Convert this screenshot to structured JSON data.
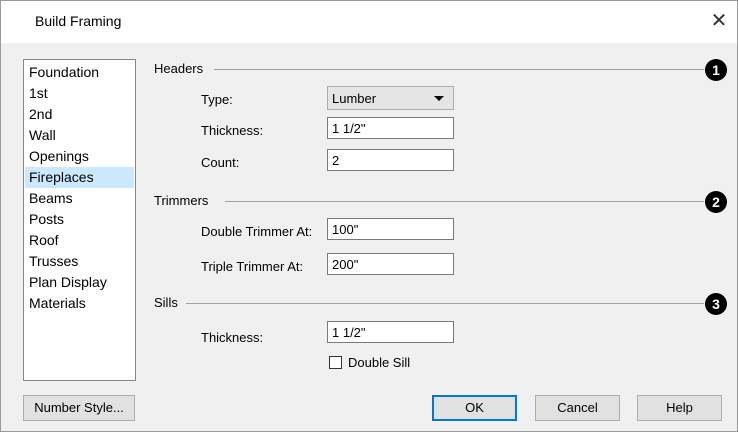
{
  "window": {
    "title": "Build Framing",
    "close_glyph": "✕"
  },
  "sidebar": {
    "items": [
      {
        "label": "Foundation"
      },
      {
        "label": "1st"
      },
      {
        "label": "2nd"
      },
      {
        "label": "Wall"
      },
      {
        "label": "Openings"
      },
      {
        "label": "Fireplaces",
        "selected": true
      },
      {
        "label": "Beams"
      },
      {
        "label": "Posts"
      },
      {
        "label": "Roof"
      },
      {
        "label": "Trusses"
      },
      {
        "label": "Plan Display"
      },
      {
        "label": "Materials"
      }
    ]
  },
  "headers": {
    "section_label": "Headers",
    "badge": "1",
    "type_label": "Type:",
    "type_value": "Lumber",
    "thickness_label": "Thickness:",
    "thickness_value": "1 1/2\"",
    "count_label": "Count:",
    "count_value": "2"
  },
  "trimmers": {
    "section_label": "Trimmers",
    "badge": "2",
    "double_label": "Double Trimmer At:",
    "double_value": "100\"",
    "triple_label": "Triple Trimmer At:",
    "triple_value": "200\""
  },
  "sills": {
    "section_label": "Sills",
    "badge": "3",
    "thickness_label": "Thickness:",
    "thickness_value": "1 1/2\"",
    "double_sill_label": "Double Sill",
    "double_sill_checked": false
  },
  "footer": {
    "number_style_label": "Number Style...",
    "ok_label": "OK",
    "cancel_label": "Cancel",
    "help_label": "Help"
  },
  "colors": {
    "selection": "#cce8ff",
    "default_button_border": "#0078d7",
    "dialog_bg": "#f0f0f0"
  }
}
